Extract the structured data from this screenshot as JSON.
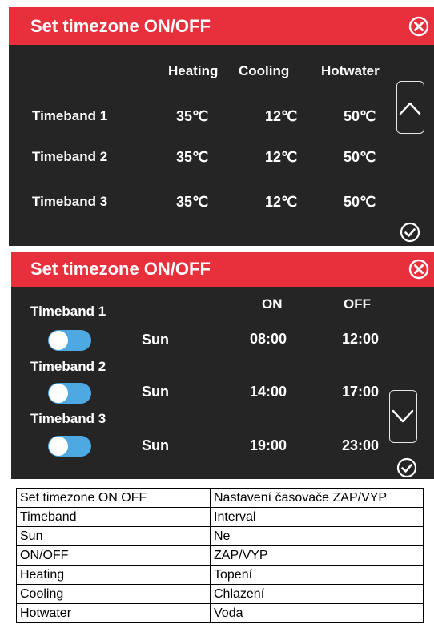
{
  "panel1": {
    "title": "Set timezone ON/OFF",
    "headers": [
      "Heating",
      "Cooling",
      "Hotwater"
    ],
    "rows": [
      {
        "label": "Timeband 1",
        "heating": "35℃",
        "cooling": "12℃",
        "hotwater": "50℃"
      },
      {
        "label": "Timeband 2",
        "heating": "35℃",
        "cooling": "12℃",
        "hotwater": "50℃"
      },
      {
        "label": "Timeband 3",
        "heating": "35℃",
        "cooling": "12℃",
        "hotwater": "50℃"
      }
    ]
  },
  "panel2": {
    "title": "Set timezone ON/OFF",
    "headers": {
      "on": "ON",
      "off": "OFF"
    },
    "rows": [
      {
        "label": "Timeband 1",
        "day": "Sun",
        "on": "08:00",
        "off": "12:00",
        "enabled": true
      },
      {
        "label": "Timeband 2",
        "day": "Sun",
        "on": "14:00",
        "off": "17:00",
        "enabled": true
      },
      {
        "label": "Timeband 3",
        "day": "Sun",
        "on": "19:00",
        "off": "23:00",
        "enabled": true
      }
    ]
  },
  "glossary": [
    {
      "en": "Set timezone ON OFF",
      "cz": "Nastavení časovače ZAP/VYP"
    },
    {
      "en": "Timeband",
      "cz": "Interval"
    },
    {
      "en": "Sun",
      "cz": "Ne"
    },
    {
      "en": "ON/OFF",
      "cz": "ZAP/VYP"
    },
    {
      "en": "Heating",
      "cz": "Topení"
    },
    {
      "en": "Cooling",
      "cz": "Chlazení"
    },
    {
      "en": "Hotwater",
      "cz": "Voda"
    }
  ],
  "icons": {
    "close": "close-circle-icon",
    "confirm": "check-circle-icon",
    "up": "chevron-up-icon",
    "down": "chevron-down-icon"
  },
  "colors": {
    "titlebar": "#e8303c",
    "panel_bg": "#252525",
    "toggle_on": "#4ea8e2"
  }
}
